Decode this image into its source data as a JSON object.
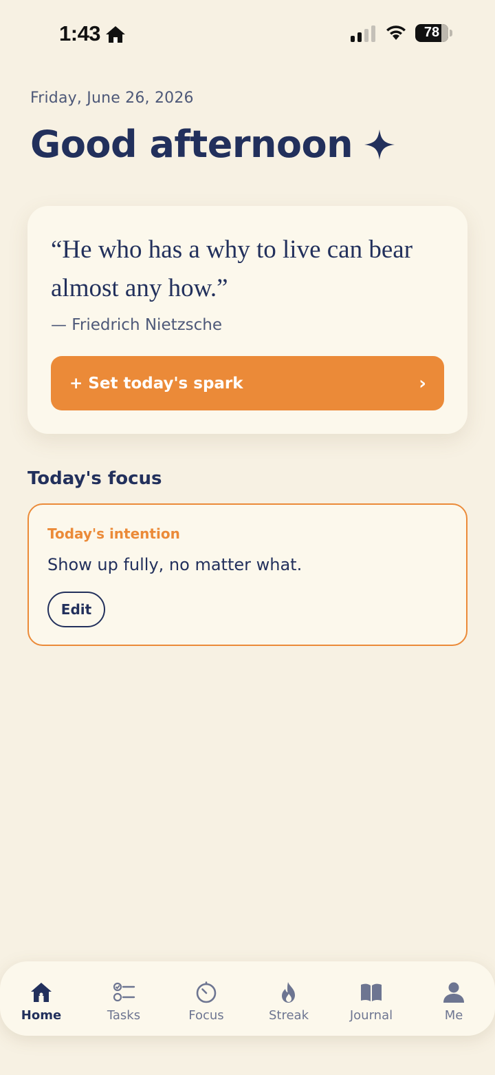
{
  "status_bar": {
    "time": "1:43",
    "battery": "78"
  },
  "header": {
    "date": "Friday, June 26, 2026",
    "greeting": "Good afternoon"
  },
  "quote_card": {
    "quote": "“He who has a why to live can bear almost any how.”",
    "author": "— Friedrich Nietzsche",
    "spark_button_label": "+ Set today's spark",
    "spark_button_chevron": "›"
  },
  "focus": {
    "section_title": "Today's focus",
    "intention_label": "Today's intention",
    "intention_text": "Show up fully, no matter what.",
    "edit_label": "Edit"
  },
  "nav": {
    "items": [
      {
        "label": "Home",
        "icon": "home-icon",
        "active": true
      },
      {
        "label": "Tasks",
        "icon": "tasks-icon",
        "active": false
      },
      {
        "label": "Focus",
        "icon": "timer-icon",
        "active": false
      },
      {
        "label": "Streak",
        "icon": "flame-icon",
        "active": false
      },
      {
        "label": "Journal",
        "icon": "book-icon",
        "active": false
      },
      {
        "label": "Me",
        "icon": "person-icon",
        "active": false
      }
    ]
  },
  "colors": {
    "background": "#f7f1e3",
    "card": "#fcf8ec",
    "accent": "#eb8a38",
    "navy": "#22305c",
    "muted": "#6d7591"
  }
}
